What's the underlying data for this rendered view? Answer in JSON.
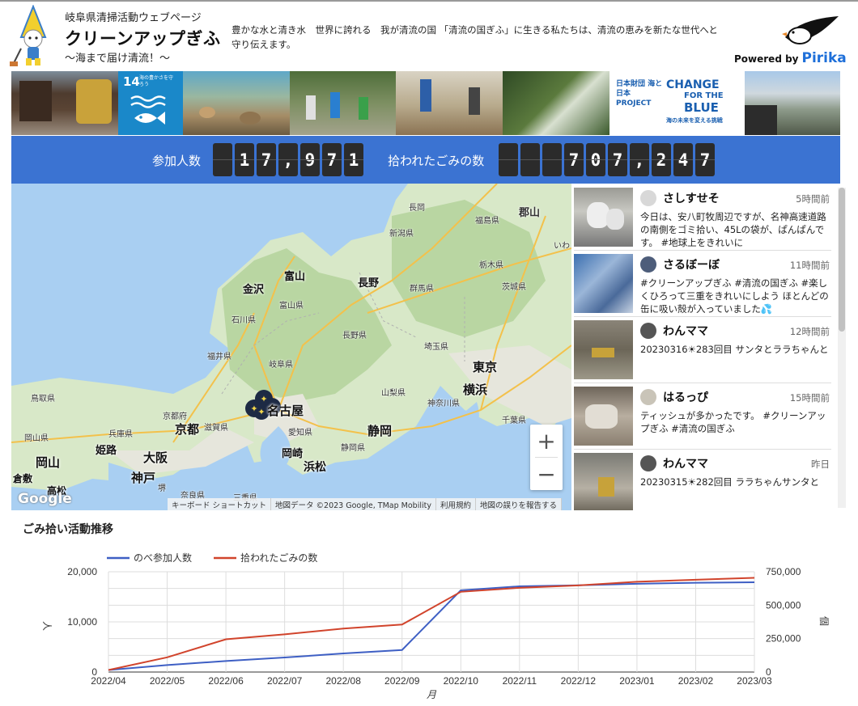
{
  "header": {
    "caption": "岐阜県清掃活動ウェブページ",
    "title": "クリーンアップぎふ",
    "tagline": "〜海まで届け清流！〜",
    "intro": "豊かな水と清き水　世界に誇れる　我が清流の国 「清流の国ぎふ」に生きる私たちは、清流の恵みを新たな世代へと守り伝えます。",
    "powered_by": "Powered by",
    "powered_brand": "Pirika"
  },
  "strip": {
    "sdg_number": "14",
    "sdg_text": "海の豊かさを守ろう",
    "change_line1": "CHANGE",
    "change_line2": "FOR THE",
    "change_line3": "BLUE",
    "change_sub": "海の未来を変える挑戦",
    "nippon_text": "日本財団 海と日本 PROJECT"
  },
  "stats": {
    "participants_label": "参加人数",
    "participants_digits": [
      " ",
      "1",
      "7",
      ",",
      "9",
      "7",
      "1"
    ],
    "trash_label": "拾われたごみの数",
    "trash_digits": [
      " ",
      " ",
      " ",
      "7",
      "0",
      "7",
      ",",
      "2",
      "4",
      "7"
    ]
  },
  "map": {
    "labels": {
      "nagaoka": "長岡",
      "fukushima": "福島県",
      "koriyama": "郡山",
      "niigata": "新潟県",
      "toyama": "富山",
      "toyama_pref": "富山県",
      "kanazawa": "金沢",
      "ishikawa": "石川県",
      "nagano": "長野",
      "nagano_pref": "長野県",
      "gunma": "群馬県",
      "tochigi": "栃木県",
      "ibaraki": "茨城県",
      "fukui": "福井県",
      "gifu": "岐阜県",
      "saitama": "埼玉県",
      "tokyo": "東京",
      "yokohama": "横浜",
      "yamanashi": "山梨県",
      "kanagawa": "神奈川県",
      "chiba": "千葉県",
      "tottori": "鳥取県",
      "kyoto_pref": "京都府",
      "nagoya": "名古屋",
      "shiga": "滋賀県",
      "kyoto": "京都",
      "aichi": "愛知県",
      "hyogo": "兵庫県",
      "okayama_pref": "岡山県",
      "himeji": "姫路",
      "osaka": "大阪",
      "okazaki": "岡崎",
      "shizuoka": "静岡",
      "shizuoka_pref": "静岡県",
      "hamamatsu": "浜松",
      "okayama": "岡山",
      "kobe": "神戸",
      "kurashiki": "倉敷",
      "sakai": "堺",
      "takamatsu": "高松",
      "nara": "奈良県",
      "mie": "三重県",
      "iwaki": "いわ"
    },
    "zoom_in": "+",
    "zoom_out": "−",
    "google_logo": "Google",
    "attribution": [
      "キーボード ショートカット",
      "地図データ ©2023 Google, TMap Mobility",
      "利用規約",
      "地図の誤りを報告する"
    ]
  },
  "feed": {
    "posts": [
      {
        "user": "さしすせそ",
        "time": "5時間前",
        "text": "今日は、安八町牧周辺ですが、名神高速道路の南側をゴミ拾い、45Lの袋が、ぱんぱんです。 #地球上をきれいに"
      },
      {
        "user": "さるぼーぼ",
        "time": "11時間前",
        "text": "#クリーンアップぎふ #清流の国ぎふ #楽しくひろって三重をきれいにしよう ほとんどの缶に吸い殻が入っていました💦"
      },
      {
        "user": "わんママ",
        "time": "12時間前",
        "text": "20230316☀283回目 サンタとララちゃんと"
      },
      {
        "user": "はるっぴ",
        "time": "15時間前",
        "text": "ティッシュが多かったです。 #クリーンアップぎふ #清流の国ぎふ"
      },
      {
        "user": "わんママ",
        "time": "昨日",
        "text": "20230315☀282回目 ララちゃんサンタと"
      }
    ]
  },
  "chart_title": "ごみ拾い活動推移",
  "chart_data": {
    "type": "line",
    "x": [
      "2022/04",
      "2022/05",
      "2022/06",
      "2022/07",
      "2022/08",
      "2022/09",
      "2022/10",
      "2022/11",
      "2022/12",
      "2023/01",
      "2023/02",
      "2023/03"
    ],
    "series": [
      {
        "name": "のべ参加人数",
        "axis": "left",
        "color": "#3e5fc4",
        "values": [
          400,
          1400,
          2200,
          2900,
          3700,
          4400,
          16300,
          17100,
          17300,
          17600,
          17800,
          17900
        ]
      },
      {
        "name": "拾われたごみの数",
        "axis": "right",
        "color": "#d1442c",
        "values": [
          15000,
          110000,
          245000,
          282000,
          325000,
          355000,
          600000,
          630000,
          648000,
          675000,
          690000,
          705000
        ]
      }
    ],
    "xlabel": "月",
    "ylabel_left": "人",
    "ylabel_right": "個",
    "ylim_left": [
      0,
      20000
    ],
    "ylim_right": [
      0,
      750000
    ],
    "yticks_left": [
      "0",
      "10,000",
      "20,000"
    ],
    "yticks_right": [
      "0",
      "250,000",
      "500,000",
      "750,000"
    ],
    "legend": "top-left",
    "grid": true
  }
}
